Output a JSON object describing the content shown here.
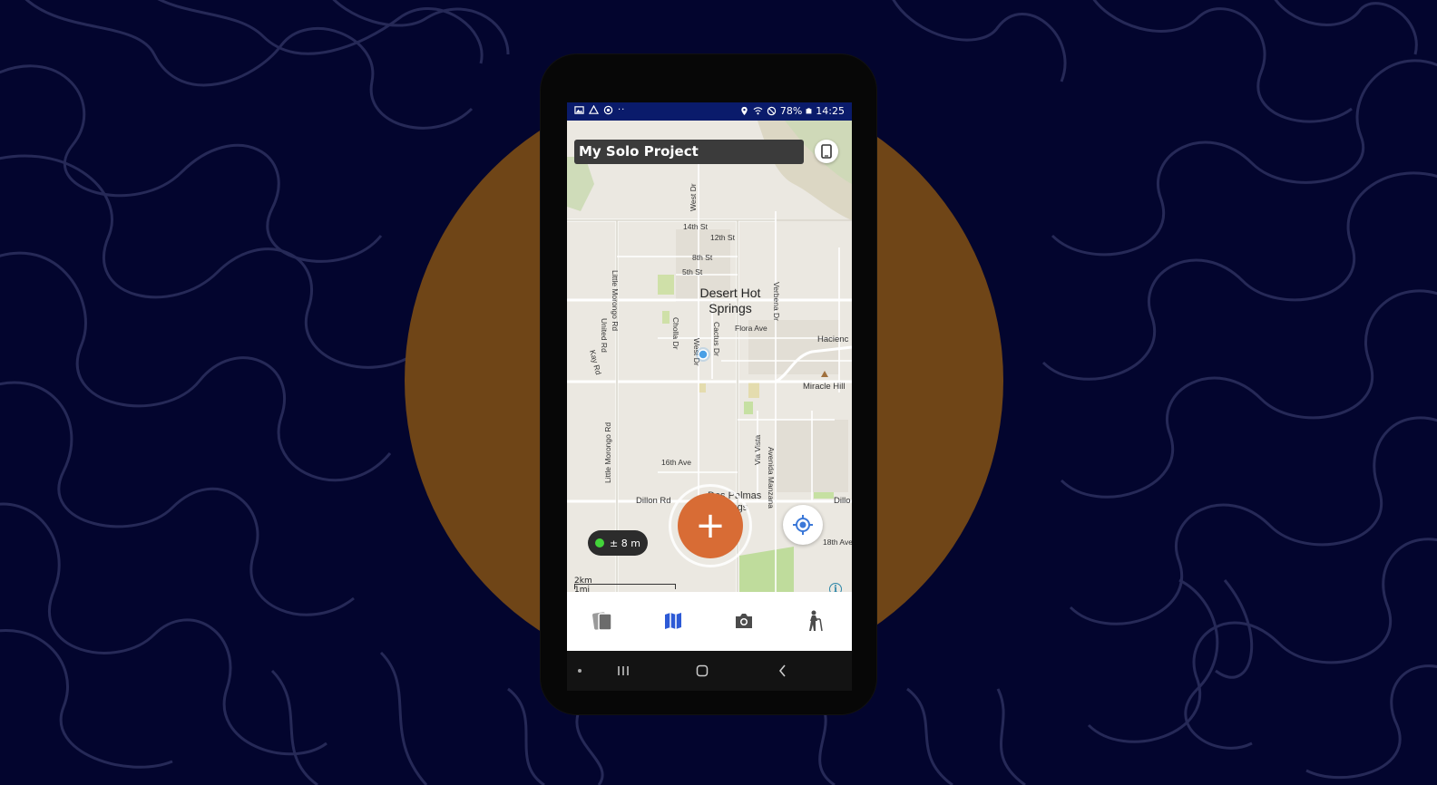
{
  "status_bar": {
    "battery": "78%",
    "time": "14:25",
    "left_icons": [
      "image-icon",
      "drive-icon",
      "sync-icon",
      "more-dots-icon"
    ],
    "right_icons": [
      "location-pin-icon",
      "wifi-icon",
      "do-not-disturb-icon",
      "battery-icon"
    ]
  },
  "project": {
    "title": "My Solo Project"
  },
  "map": {
    "city_label_line1": "Desert Hot",
    "city_label_line2": "Springs",
    "other_place": "Miracle Hill",
    "hacienda": "Hacienc",
    "des_palmas": "Des Palmas",
    "springs_partial": "Springs",
    "streets": {
      "s14th": "14th St",
      "s12th": "12th St",
      "s8th": "8th St",
      "s5th": "5th St",
      "west_dr": "West Dr",
      "little_morongo": "Little Morongo Rd",
      "united": "United Rd",
      "kay": "Kay Rd",
      "cholla": "Cholla Dr",
      "cactus": "Cactus Dr",
      "flora": "Flora Ave",
      "verbena": "Verbena Dr",
      "ave16": "16th Ave",
      "via_vista": "Via Vista",
      "avenida_manzana": "Avenida Manzana",
      "dillon": "Dillon Rd",
      "dillo_partial": "Dillo",
      "ave18": "18th Ave"
    },
    "accuracy": "± 8 m",
    "scale_km": "2km",
    "scale_mi": "1mi",
    "info_glyph": "i"
  },
  "fab": {
    "glyph": "+"
  },
  "tabs": [
    {
      "name": "projects-tab",
      "icon": "cards-icon"
    },
    {
      "name": "map-tab",
      "icon": "map-icon",
      "active": true
    },
    {
      "name": "camera-tab",
      "icon": "camera-icon"
    },
    {
      "name": "hike-tab",
      "icon": "hiker-icon"
    }
  ],
  "colors": {
    "background": "#03052e",
    "disc": "#6f4517",
    "status_bar": "#0a1b6b",
    "fab": "#d86c35",
    "active_tab": "#2d5ad6",
    "gps_ok": "#43d43a"
  }
}
